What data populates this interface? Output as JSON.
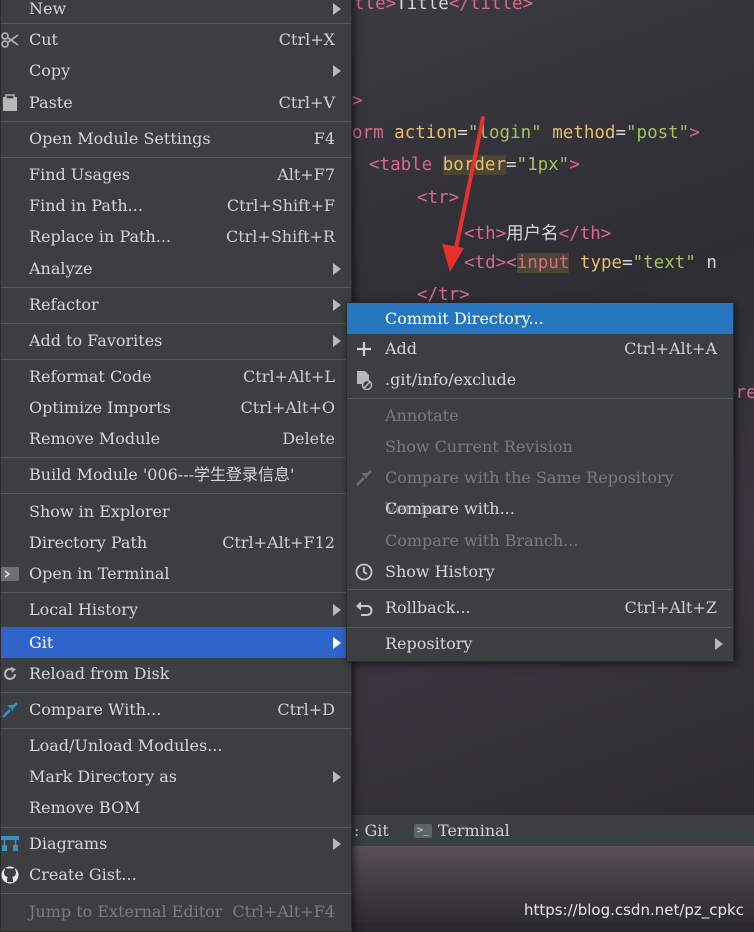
{
  "editor": {
    "line1": {
      "pre": "tle>",
      "mid": "Title",
      "post": "</title>"
    },
    "line2": ">",
    "line3": {
      "pre": "orm ",
      "a1": "action",
      "v1": "\"login\"",
      "a2": " method",
      "v2": "\"post\"",
      "end": ">"
    },
    "line4": {
      "open": "<table ",
      "attr": "border",
      "eq": "=",
      "val": "\"1px\"",
      "close": ">"
    },
    "line5": "<tr>",
    "line6": {
      "open": "<th>",
      "text": "用户名",
      "close": "</th>"
    },
    "line7": {
      "open": "<td><",
      "tag": "input",
      "attr": " type",
      "val": "\"text\"",
      "tail": " n"
    },
    "line8": "</tr>",
    "line9": "ore",
    "accent_arrow": "#e8302a"
  },
  "context_menu": {
    "new": "New",
    "cut": {
      "label": "Cut",
      "shortcut": "Ctrl+X"
    },
    "copy": "Copy",
    "paste": {
      "label": "Paste",
      "shortcut": "Ctrl+V"
    },
    "open_module_settings": {
      "label": "Open Module Settings",
      "shortcut": "F4"
    },
    "find_usages": {
      "label": "Find Usages",
      "shortcut": "Alt+F7"
    },
    "find_in_path": {
      "label": "Find in Path...",
      "shortcut": "Ctrl+Shift+F"
    },
    "replace_in_path": {
      "label": "Replace in Path...",
      "shortcut": "Ctrl+Shift+R"
    },
    "analyze": "Analyze",
    "refactor": "Refactor",
    "add_to_favorites": "Add to Favorites",
    "reformat_code": {
      "label": "Reformat Code",
      "shortcut": "Ctrl+Alt+L"
    },
    "optimize_imports": {
      "label": "Optimize Imports",
      "shortcut": "Ctrl+Alt+O"
    },
    "remove_module": {
      "label": "Remove Module",
      "shortcut": "Delete"
    },
    "build_module": "Build Module '006---学生登录信息'",
    "show_in_explorer": "Show in Explorer",
    "directory_path": {
      "label": "Directory Path",
      "shortcut": "Ctrl+Alt+F12"
    },
    "open_in_terminal": "Open in Terminal",
    "local_history": "Local History",
    "git": "Git",
    "reload_from_disk": "Reload from Disk",
    "compare_with": {
      "label": "Compare With...",
      "shortcut": "Ctrl+D"
    },
    "load_unload_modules": "Load/Unload Modules...",
    "mark_directory_as": "Mark Directory as",
    "remove_bom": "Remove BOM",
    "diagrams": "Diagrams",
    "create_gist": "Create Gist...",
    "jump_to_external_editor": {
      "label": "Jump to External Editor",
      "shortcut": "Ctrl+Alt+F4"
    }
  },
  "git_menu": {
    "commit_directory": "Commit Directory...",
    "add": {
      "label": "Add",
      "shortcut": "Ctrl+Alt+A"
    },
    "exclude": ".git/info/exclude",
    "annotate": "Annotate",
    "show_current_revision": "Show Current Revision",
    "compare_same_repo": "Compare with the Same Repository Version",
    "compare_with": "Compare with...",
    "compare_with_branch": "Compare with Branch...",
    "show_history": "Show History",
    "rollback": {
      "label": "Rollback...",
      "shortcut": "Ctrl+Alt+Z"
    },
    "repository": "Repository"
  },
  "toolbar": {
    "git_tab": ": Git",
    "terminal_tab": "Terminal"
  },
  "watermark": "https://blog.csdn.net/pz_cpkc",
  "colors": {
    "menu_bg": "#3c3f41",
    "selection": "#2f65ca",
    "git_selection": "#2675bf"
  }
}
